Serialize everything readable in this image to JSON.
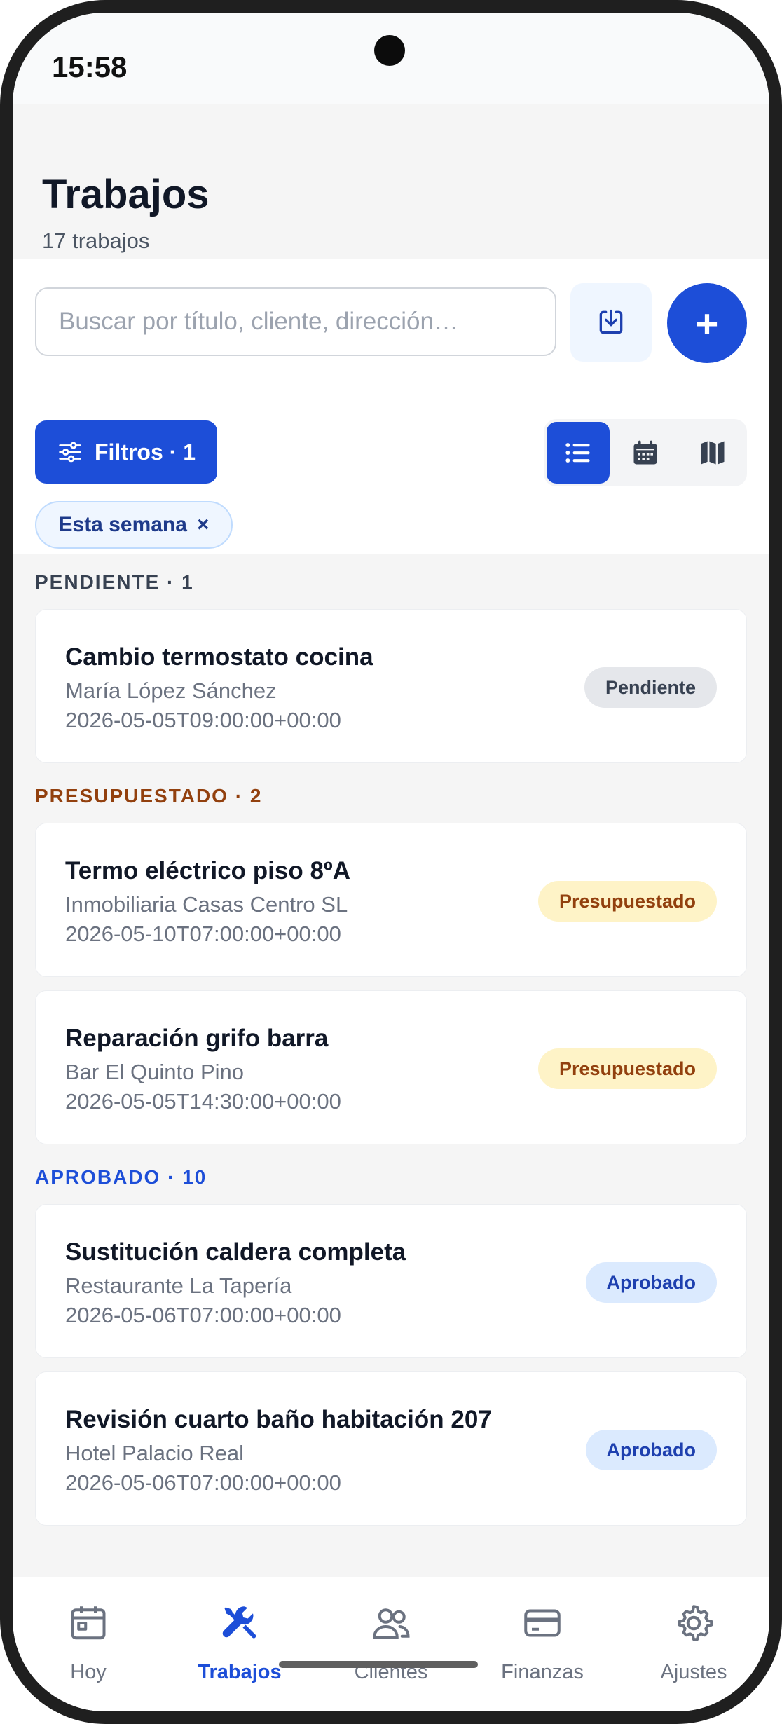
{
  "status_bar": {
    "time": "15:58"
  },
  "header": {
    "title": "Trabajos",
    "subtitle": "17 trabajos"
  },
  "search": {
    "placeholder": "Buscar por título, cliente, dirección…",
    "value": ""
  },
  "toolbar": {
    "export_icon": "download-icon",
    "add_label": "+",
    "filters_label": "Filtros · 1",
    "views": [
      {
        "icon": "list-icon",
        "active": true
      },
      {
        "icon": "calendar-icon",
        "active": false
      },
      {
        "icon": "map-icon",
        "active": false
      }
    ]
  },
  "active_chip": {
    "label": "Esta semana",
    "remove": "×"
  },
  "groups": [
    {
      "label": "PENDIENTE · 1",
      "color": "#374151",
      "jobs": [
        {
          "title": "Cambio termostato cocina",
          "client": "María López Sánchez",
          "date": "2026-05-05T09:00:00+00:00",
          "status": "Pendiente"
        }
      ]
    },
    {
      "label": "PRESUPUESTADO · 2",
      "color": "#92400e",
      "jobs": [
        {
          "title": "Termo eléctrico piso 8ºA",
          "client": "Inmobiliaria Casas Centro SL",
          "date": "2026-05-10T07:00:00+00:00",
          "status": "Presupuestado"
        },
        {
          "title": "Reparación grifo barra",
          "client": "Bar El Quinto Pino",
          "date": "2026-05-05T14:30:00+00:00",
          "status": "Presupuestado"
        }
      ]
    },
    {
      "label": "APROBADO · 10",
      "color": "#1d4ed8",
      "jobs": [
        {
          "title": "Sustitución caldera completa",
          "client": "Restaurante La Tapería",
          "date": "2026-05-06T07:00:00+00:00",
          "status": "Aprobado"
        },
        {
          "title": "Revisión cuarto baño habitación 207",
          "client": "Hotel Palacio Real",
          "date": "2026-05-06T07:00:00+00:00",
          "status": "Aprobado"
        }
      ]
    }
  ],
  "nav": [
    {
      "label": "Hoy",
      "icon": "calendar-day-icon",
      "active": false
    },
    {
      "label": "Trabajos",
      "icon": "tools-icon",
      "active": true
    },
    {
      "label": "Clientes",
      "icon": "users-icon",
      "active": false
    },
    {
      "label": "Finanzas",
      "icon": "credit-card-icon",
      "active": false
    },
    {
      "label": "Ajustes",
      "icon": "gear-icon",
      "active": false
    }
  ]
}
